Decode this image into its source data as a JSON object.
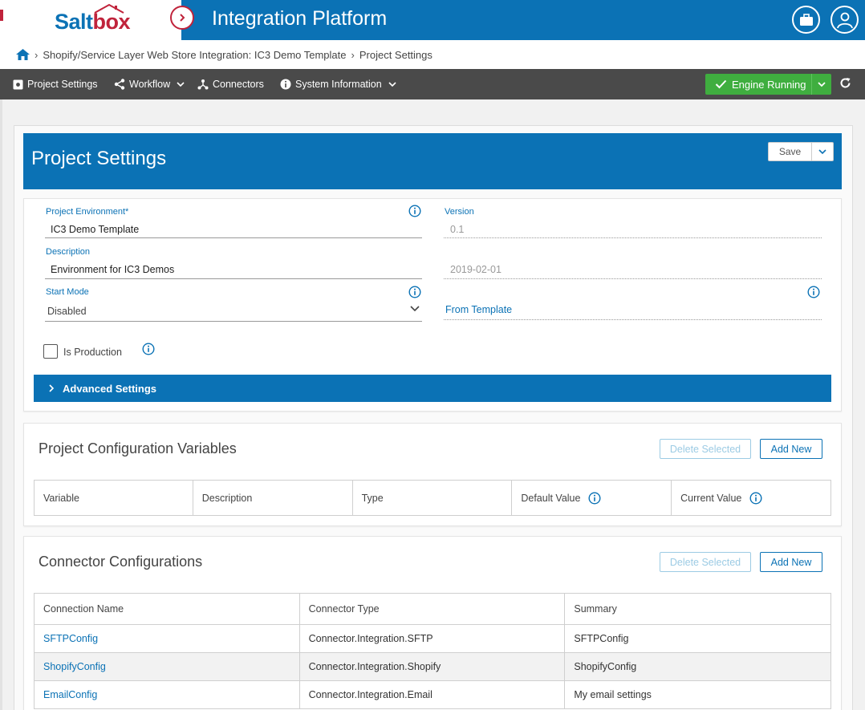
{
  "header": {
    "logo_main": "Salt",
    "logo_accent": "box",
    "title": "Integration Platform",
    "icons": [
      "briefcase-icon",
      "user-icon"
    ]
  },
  "breadcrumb": {
    "home_icon": "home-icon",
    "items": [
      "Shopify/Service Layer Web Store Integration: IC3 Demo Template",
      "Project Settings"
    ]
  },
  "toolbar": {
    "project_settings": "Project Settings",
    "workflow": "Workflow",
    "connectors": "Connectors",
    "system_information": "System Information",
    "engine_status": "Engine Running"
  },
  "project_settings": {
    "title": "Project Settings",
    "save_label": "Save",
    "environment_label": "Project Environment*",
    "environment_value": "IC3 Demo Template",
    "version_label": "Version",
    "version_value": "0.1",
    "description_label": "Description",
    "description_value": "Environment for IC3 Demos",
    "date_value": "2019-02-01",
    "start_mode_label": "Start Mode",
    "start_mode_value": "Disabled",
    "from_template": "From Template",
    "is_production_label": "Is Production",
    "advanced_settings": "Advanced Settings"
  },
  "config_variables": {
    "title": "Project Configuration Variables",
    "delete_label": "Delete Selected",
    "add_label": "Add New",
    "columns": [
      "Variable",
      "Description",
      "Type",
      "Default Value",
      "Current Value"
    ]
  },
  "connector_configs": {
    "title": "Connector Configurations",
    "delete_label": "Delete Selected",
    "add_label": "Add New",
    "columns": [
      "Connection Name",
      "Connector Type",
      "Summary"
    ],
    "rows": [
      {
        "name": "SFTPConfig",
        "type": "Connector.Integration.SFTP",
        "summary": "SFTPConfig"
      },
      {
        "name": "ShopifyConfig",
        "type": "Connector.Integration.Shopify",
        "summary": "ShopifyConfig"
      },
      {
        "name": "EmailConfig",
        "type": "Connector.Integration.Email",
        "summary": "My email settings"
      }
    ]
  },
  "colors": {
    "primary": "#0b72b5",
    "accent_red": "#c0233b",
    "toolbar_bg": "#4a4a4a",
    "engine_green": "#3fae3f"
  }
}
